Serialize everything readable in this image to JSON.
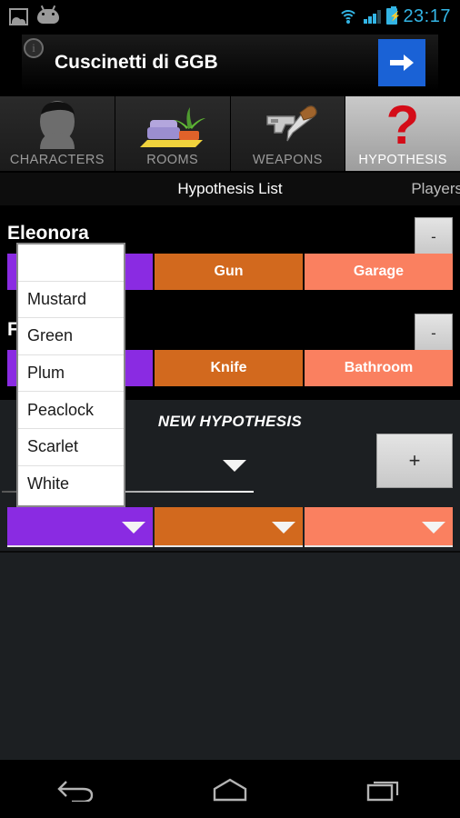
{
  "statusbar": {
    "icons": [
      "photo-icon",
      "android-icon",
      "wifi-icon",
      "signal-icon",
      "battery-icon"
    ],
    "battery_glyph": "⚡",
    "time": "23:17",
    "accent": "#33b5e5"
  },
  "ad": {
    "title": "Cuscinetti di GGB",
    "cta_icon": "arrow-right-icon",
    "info_glyph": "i",
    "cta_color": "#1a62d6"
  },
  "tabs": [
    {
      "label": "CHARACTERS",
      "icon": "person-silhouette-icon",
      "selected": false
    },
    {
      "label": "ROOMS",
      "icon": "sofa-plant-icon",
      "selected": false
    },
    {
      "label": "WEAPONS",
      "icon": "gun-knife-icon",
      "selected": false
    },
    {
      "label": "HYPOTHESIS",
      "icon": "question-mark-icon",
      "selected": true
    }
  ],
  "subtabs": {
    "selected": "Hypothesis List",
    "other": "Players"
  },
  "hypotheses": [
    {
      "name": "Eleonora",
      "character": "",
      "weapon": "Gun",
      "room": "Garage",
      "remove_label": "-"
    },
    {
      "name": "F",
      "character": "",
      "weapon": "Knife",
      "room": "Bathroom",
      "remove_label": "-"
    }
  ],
  "new_hypothesis": {
    "title": "NEW HYPOTHESIS",
    "add_label": "+",
    "player_value": "",
    "character_value": "",
    "weapon_value": "",
    "room_value": "",
    "dropdown_icon": "chevron-down-icon"
  },
  "dropdown": {
    "open": true,
    "items": [
      "",
      "Mustard",
      "Green",
      "Plum",
      "Peaclock",
      "Scarlet",
      "White"
    ]
  },
  "colors": {
    "character": "#8A2BE2",
    "weapon": "#D2691E",
    "room": "#FA8060",
    "panel": "#1c1f22",
    "accent_blue": "#33b5e5"
  },
  "navbar": {
    "buttons": [
      "back-icon",
      "home-icon",
      "recents-icon"
    ]
  }
}
